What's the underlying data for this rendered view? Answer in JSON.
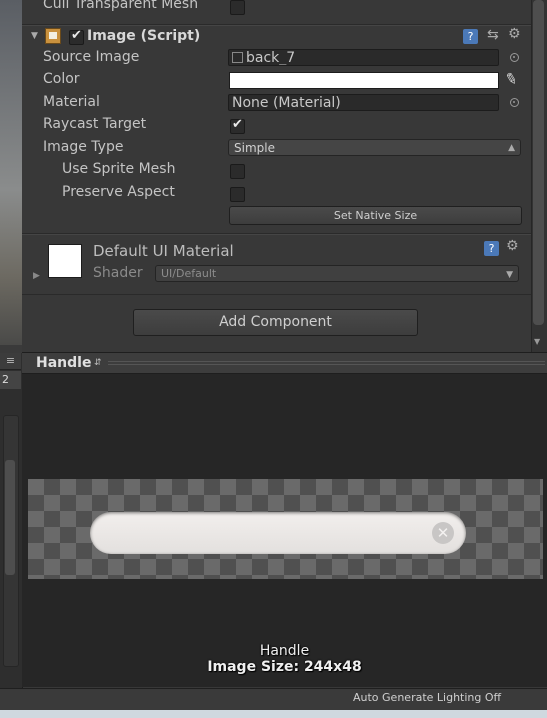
{
  "inspector": {
    "cull_mesh_label": "Cull Transparent Mesh",
    "component_title": "Image (Script)",
    "rows": {
      "source_image": {
        "label": "Source Image",
        "value": "back_7"
      },
      "color": {
        "label": "Color"
      },
      "material": {
        "label": "Material",
        "value": "None (Material)"
      },
      "raycast": {
        "label": "Raycast Target"
      },
      "image_type": {
        "label": "Image Type",
        "value": "Simple"
      },
      "use_sprite_mesh": {
        "label": "Use Sprite Mesh"
      },
      "preserve_aspect": {
        "label": "Preserve Aspect"
      }
    },
    "set_native_size": "Set Native Size",
    "material_block": {
      "name": "Default UI Material",
      "shader_label": "Shader",
      "shader_value": "UI/Default"
    },
    "add_component": "Add Component"
  },
  "preview": {
    "header_title": "Handle",
    "caption_name": "Handle",
    "caption_size": "Image Size: 244x48"
  },
  "left_panel": {
    "number": "2"
  },
  "status": {
    "text": "Auto Generate Lighting Off"
  },
  "colors": {
    "color_swatch": "#ffffff",
    "panel_bg": "#383838",
    "preview_bg": "#262626"
  }
}
